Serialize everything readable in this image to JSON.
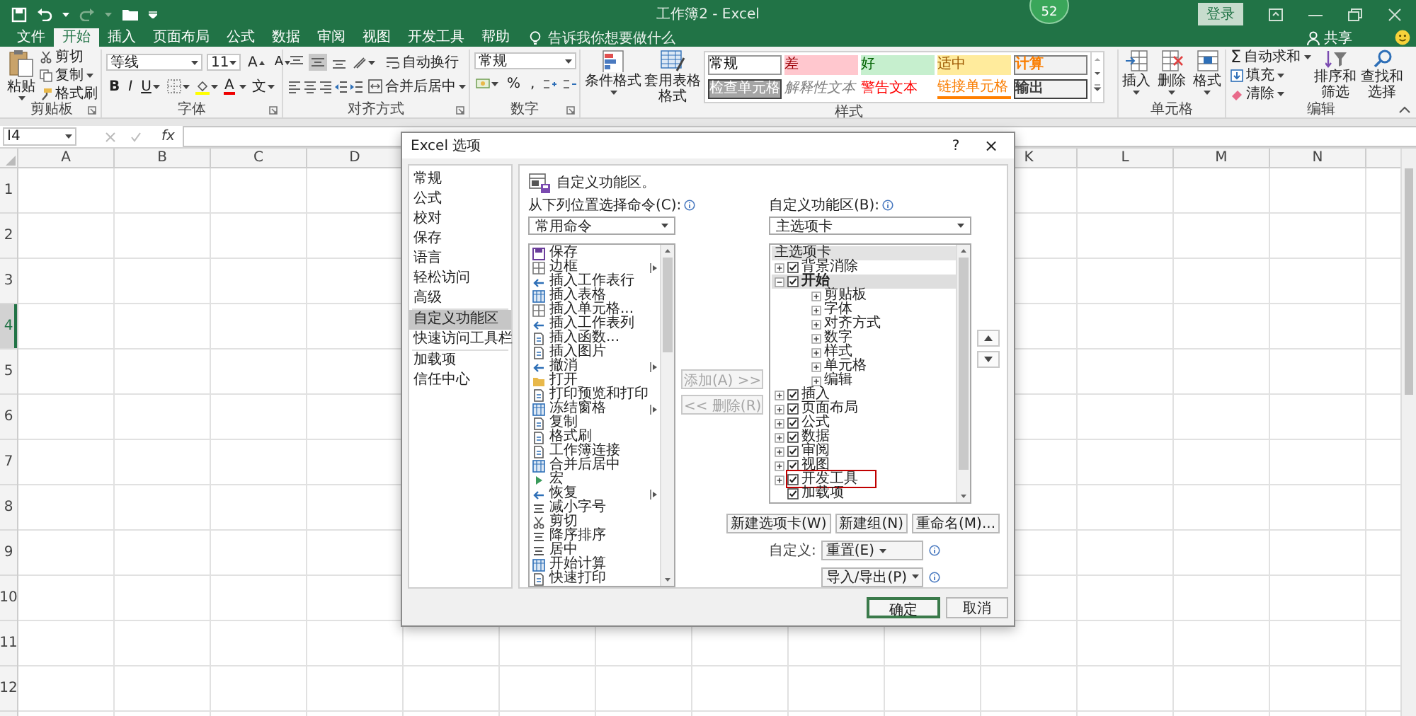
{
  "title_bar": {
    "title": "工作簿2 - Excel",
    "badge": "52",
    "sign_in": "登录"
  },
  "ribbon_tabs": [
    {
      "label": "文件",
      "selected": false
    },
    {
      "label": "开始",
      "selected": true
    },
    {
      "label": "插入",
      "selected": false
    },
    {
      "label": "页面布局",
      "selected": false
    },
    {
      "label": "公式",
      "selected": false
    },
    {
      "label": "数据",
      "selected": false
    },
    {
      "label": "审阅",
      "selected": false
    },
    {
      "label": "视图",
      "selected": false
    },
    {
      "label": "开发工具",
      "selected": false
    },
    {
      "label": "帮助",
      "selected": false
    }
  ],
  "tell_me": "告诉我你想要做什么",
  "share": "共享",
  "ribbon": {
    "clipboard": {
      "label": "剪贴板",
      "paste": "粘贴",
      "cut": "剪切",
      "copy": "复制",
      "format_painter": "格式刷"
    },
    "font": {
      "label": "字体",
      "font_name": "等线",
      "font_size": "11",
      "grow": "A",
      "shrink": "A",
      "bold": "B",
      "italic": "I",
      "underline": "U",
      "font_color": "A",
      "phonetic": "文"
    },
    "alignment": {
      "label": "对齐方式",
      "vertical_align_buttons": [
        {
          "kind": "top",
          "selected": false
        },
        {
          "kind": "middle",
          "selected": true
        },
        {
          "kind": "bottom",
          "selected": false
        }
      ],
      "wrap_text": "自动换行",
      "merge_center": "合并后居中"
    },
    "number": {
      "label": "数字",
      "format": "常规",
      "percent": "%",
      "comma": ","
    },
    "styles": {
      "label": "样式",
      "conditional_formatting": "条件格式",
      "format_as_table": "套用表格格式",
      "cell_styles": [
        {
          "label": "常规",
          "kind": "normal"
        },
        {
          "label": "差",
          "kind": "bad"
        },
        {
          "label": "好",
          "kind": "good"
        },
        {
          "label": "适中",
          "kind": "neutral"
        },
        {
          "label": "计算",
          "kind": "calculation"
        },
        {
          "label": "检查单元格",
          "kind": "check"
        },
        {
          "label": "解释性文本",
          "kind": "explanatory"
        },
        {
          "label": "警告文本",
          "kind": "warning"
        },
        {
          "label": "链接单元格",
          "kind": "linked"
        },
        {
          "label": "输出",
          "kind": "output"
        }
      ]
    },
    "cells": {
      "label": "单元格",
      "insert": "插入",
      "delete": "删除",
      "format": "格式"
    },
    "editing": {
      "label": "编辑",
      "autosum_symbol": "Σ",
      "autosum": "自动求和",
      "fill": "填充",
      "clear": "清除",
      "sort_filter": "排序和筛选",
      "find_select": "查找和选择"
    }
  },
  "formula_bar": {
    "name_box": "I4",
    "fx": "fx"
  },
  "sheet": {
    "columns_left": [
      "A",
      "B",
      "C",
      "D"
    ],
    "columns_right": [
      "K",
      "L",
      "M",
      "N"
    ],
    "rows": [
      {
        "label": "1",
        "selected": false
      },
      {
        "label": "2",
        "selected": false
      },
      {
        "label": "3",
        "selected": false
      },
      {
        "label": "4",
        "selected": true
      },
      {
        "label": "5",
        "selected": false
      },
      {
        "label": "6",
        "selected": false
      },
      {
        "label": "7",
        "selected": false
      },
      {
        "label": "8",
        "selected": false
      },
      {
        "label": "9",
        "selected": false
      },
      {
        "label": "10",
        "selected": false
      },
      {
        "label": "11",
        "selected": false
      },
      {
        "label": "12",
        "selected": false
      }
    ]
  },
  "dialog": {
    "title": "Excel 选项",
    "help": "?",
    "close": "×",
    "nav": [
      {
        "label": "常规",
        "selected": false
      },
      {
        "label": "公式",
        "selected": false
      },
      {
        "label": "校对",
        "selected": false
      },
      {
        "label": "保存",
        "selected": false
      },
      {
        "label": "语言",
        "selected": false
      },
      {
        "label": "轻松访问",
        "selected": false
      },
      {
        "label": "高级",
        "selected": false
      },
      {
        "label": "自定义功能区",
        "selected": true
      },
      {
        "label": "快速访问工具栏",
        "selected": false
      },
      {
        "label": "加载项",
        "selected": false
      },
      {
        "label": "信任中心",
        "selected": false
      }
    ],
    "heading": "自定义功能区。",
    "commands_label": "从下列位置选择命令(C):",
    "commands_source": "常用命令",
    "commands": [
      {
        "label": "保存",
        "submenu": false
      },
      {
        "label": "边框",
        "submenu": true
      },
      {
        "label": "插入工作表行",
        "submenu": false
      },
      {
        "label": "插入表格",
        "submenu": false
      },
      {
        "label": "插入单元格...",
        "submenu": false
      },
      {
        "label": "插入工作表列",
        "submenu": false
      },
      {
        "label": "插入函数...",
        "submenu": false
      },
      {
        "label": "插入图片",
        "submenu": false
      },
      {
        "label": "撤消",
        "submenu": true
      },
      {
        "label": "打开",
        "submenu": false
      },
      {
        "label": "打印预览和打印",
        "submenu": false
      },
      {
        "label": "冻结窗格",
        "submenu": true
      },
      {
        "label": "复制",
        "submenu": false
      },
      {
        "label": "格式刷",
        "submenu": false
      },
      {
        "label": "工作簿连接",
        "submenu": false
      },
      {
        "label": "合并后居中",
        "submenu": false
      },
      {
        "label": "宏",
        "submenu": false
      },
      {
        "label": "恢复",
        "submenu": true
      },
      {
        "label": "减小字号",
        "submenu": false
      },
      {
        "label": "剪切",
        "submenu": false
      },
      {
        "label": "降序排序",
        "submenu": false
      },
      {
        "label": "居中",
        "submenu": false
      },
      {
        "label": "开始计算",
        "submenu": false
      },
      {
        "label": "快速打印",
        "submenu": false
      }
    ],
    "add": {
      "label": "添加(A) >>",
      "disabled": true
    },
    "remove": {
      "label": "<< 删除(R)",
      "disabled": true
    },
    "ribbon_label": "自定义功能区(B):",
    "ribbon_source": "主选项卡",
    "tree_header": "主选项卡",
    "ribbon_tree": [
      {
        "label": "背景消除",
        "kind": "tab",
        "checked": true,
        "expanded": false,
        "selected": false,
        "highlighted": false
      },
      {
        "label": "开始",
        "kind": "tab",
        "checked": true,
        "expanded": true,
        "selected": true,
        "highlighted": false,
        "children": [
          {
            "label": "剪贴板"
          },
          {
            "label": "字体"
          },
          {
            "label": "对齐方式"
          },
          {
            "label": "数字"
          },
          {
            "label": "样式"
          },
          {
            "label": "单元格"
          },
          {
            "label": "编辑"
          }
        ]
      },
      {
        "label": "插入",
        "kind": "tab",
        "checked": true,
        "expanded": false,
        "selected": false,
        "highlighted": false
      },
      {
        "label": "页面布局",
        "kind": "tab",
        "checked": true,
        "expanded": false,
        "selected": false,
        "highlighted": false
      },
      {
        "label": "公式",
        "kind": "tab",
        "checked": true,
        "expanded": false,
        "selected": false,
        "highlighted": false
      },
      {
        "label": "数据",
        "kind": "tab",
        "checked": true,
        "expanded": false,
        "selected": false,
        "highlighted": false
      },
      {
        "label": "审阅",
        "kind": "tab",
        "checked": true,
        "expanded": false,
        "selected": false,
        "highlighted": false
      },
      {
        "label": "视图",
        "kind": "tab",
        "checked": true,
        "expanded": false,
        "selected": false,
        "highlighted": false
      },
      {
        "label": "开发工具",
        "kind": "tab",
        "checked": true,
        "expanded": false,
        "selected": false,
        "highlighted": true
      },
      {
        "label": "加载项",
        "kind": "addin",
        "checked": true,
        "selected": false,
        "highlighted": false
      }
    ],
    "new_tab": "新建选项卡(W)",
    "new_group": "新建组(N)",
    "rename": "重命名(M)...",
    "customizations_label": "自定义:",
    "reset": "重置(E)",
    "import_export": "导入/导出(P)",
    "ok": "确定",
    "cancel": "取消"
  }
}
